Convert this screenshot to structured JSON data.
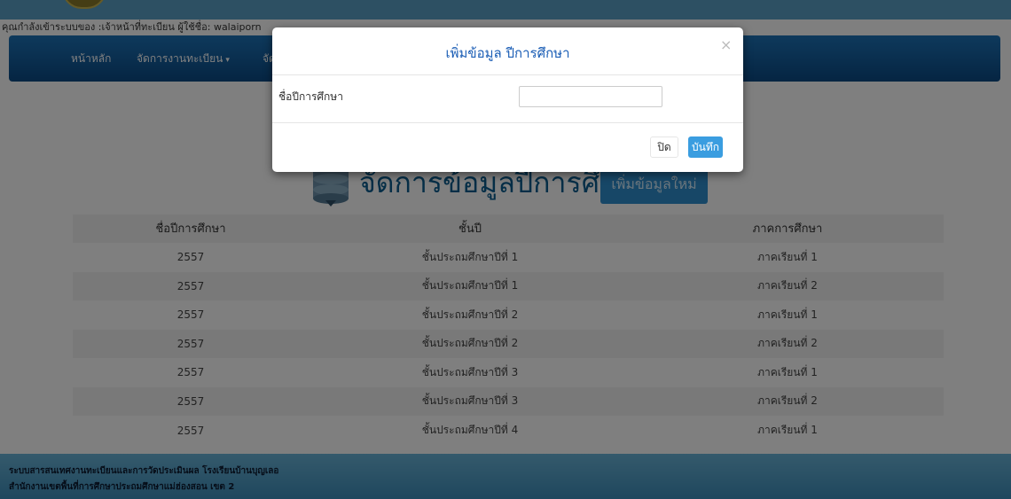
{
  "header": {
    "login_status": "คุณกำลังเข้าระบบของ :เจ้าหน้าที่ทะเบียน ผู้ใช้ชื่อ: walaiporn"
  },
  "nav": {
    "items": [
      {
        "label": "หน้าหลัก"
      },
      {
        "label": "จัดการงานทะเบียน",
        "caret": "▾"
      },
      {
        "label": "จัด"
      }
    ]
  },
  "main": {
    "heading": "จัดการข้อมูลปีการศึกษา",
    "add_button": "เพิ่มข้อมูลใหม่",
    "icon": "database-icon"
  },
  "table": {
    "columns": [
      "ชื่อปีการศึกษา",
      "ชั้นปี",
      "ภาคการศึกษา"
    ],
    "rows": [
      [
        "2557",
        "ชั้นประถมศึกษาปีที่ 1",
        "ภาคเรียนที่ 1"
      ],
      [
        "2557",
        "ชั้นประถมศึกษาปีที่ 1",
        "ภาคเรียนที่ 2"
      ],
      [
        "2557",
        "ชั้นประถมศึกษาปีที่ 2",
        "ภาคเรียนที่ 1"
      ],
      [
        "2557",
        "ชั้นประถมศึกษาปีที่ 2",
        "ภาคเรียนที่ 2"
      ],
      [
        "2557",
        "ชั้นประถมศึกษาปีที่ 3",
        "ภาคเรียนที่ 1"
      ],
      [
        "2557",
        "ชั้นประถมศึกษาปีที่ 3",
        "ภาคเรียนที่ 2"
      ],
      [
        "2557",
        "ชั้นประถมศึกษาปีที่ 4",
        "ภาคเรียนที่ 1"
      ]
    ]
  },
  "footer": {
    "line1": "ระบบสารสนเทศงานทะเบียนและการวัดประเมินผล โรงเรียนบ้านบุญเลอ",
    "line2": "สำนักงานเขตพื้นที่การศึกษาประถมศึกษาแม่ฮ่องสอน เขต 2"
  },
  "modal": {
    "title": "เพิ่มข้อมูล ปีการศึกษา",
    "close_icon": "×",
    "field_label": "ชื่อปีการศึกษา",
    "field_value": "",
    "close_button": "ปิด",
    "save_button": "บันทึก"
  },
  "colors": {
    "navbar": "#0b4a85",
    "accent": "#3a9de0",
    "modal_title": "#1a5db5"
  }
}
